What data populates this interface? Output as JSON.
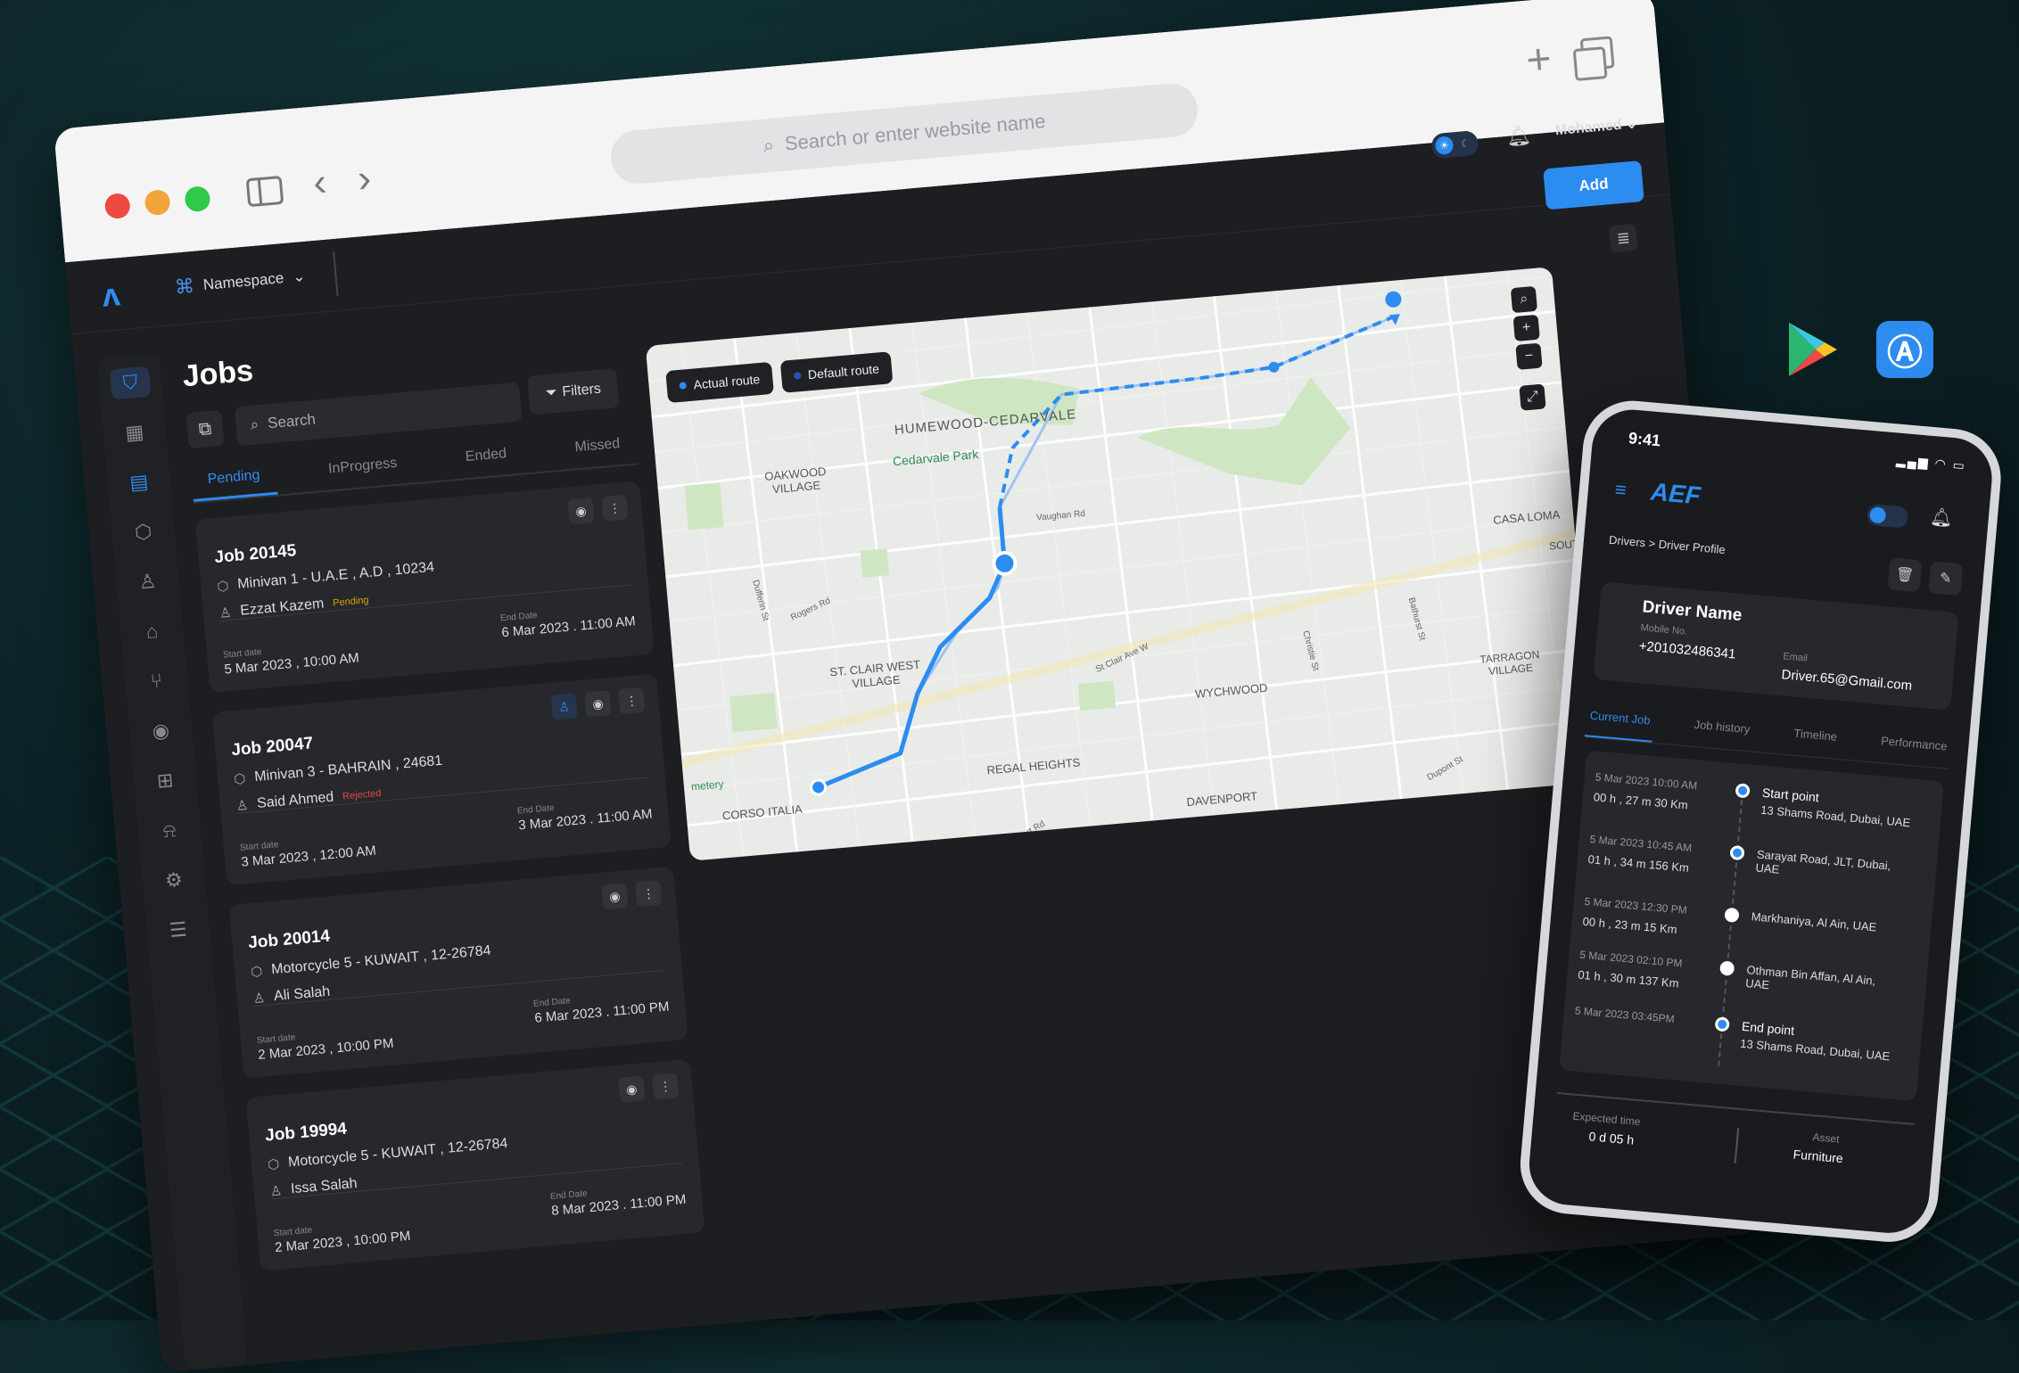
{
  "browser": {
    "url_placeholder": "Search or enter website name",
    "plus_icon": "+"
  },
  "app": {
    "namespace_label": "Namespace",
    "user_name": "Mohamed",
    "add_label": "Add",
    "jobs_title": "Jobs",
    "filters_label": "Filters",
    "search_placeholder": "Search",
    "tabs": [
      "Pending",
      "InProgress",
      "Ended",
      "Missed"
    ],
    "active_tab": "Pending",
    "start_label": "Start date",
    "end_label": "End Date",
    "jobs": [
      {
        "title": "Job 20145",
        "vehicle": "Minivan 1 - U.A.E , A.D , 10234",
        "driver": "Ezzat Kazem",
        "status": "Pending",
        "start": "5 Mar 2023 , 10:00 AM",
        "end": "6 Mar 2023 . 11:00 AM"
      },
      {
        "title": "Job 20047",
        "vehicle": "Minivan 3 - BAHRAIN , 24681",
        "driver": "Said Ahmed",
        "status": "Rejected",
        "start": "3 Mar 2023 , 12:00 AM",
        "end": "3 Mar 2023 . 11:00 AM"
      },
      {
        "title": "Job 20014",
        "vehicle": "Motorcycle 5 - KUWAIT , 12-26784",
        "driver": "Ali Salah",
        "status": "",
        "start": "2 Mar 2023 , 10:00 PM",
        "end": "6 Mar 2023 . 11:00 PM"
      },
      {
        "title": "Job 19994",
        "vehicle": "Motorcycle 5 - KUWAIT , 12-26784",
        "driver": "Issa Salah",
        "status": "",
        "start": "2 Mar 2023 , 10:00 PM",
        "end": "8 Mar 2023 . 11:00 PM"
      }
    ],
    "map": {
      "actual_route": "Actual route",
      "default_route": "Default route",
      "places": [
        "HUMEWOOD-CEDARVALE",
        "Cedarvale Park",
        "OAKWOOD VILLAGE",
        "CASA LOMA",
        "ST. CLAIR WEST VILLAGE",
        "WYCHWOOD",
        "TARRAGON VILLAGE",
        "REGAL HEIGHTS",
        "CORSO ITALIA",
        "DAVENPORT",
        "SOUTH",
        "Vaughan Rd",
        "St Clair Ave W",
        "Dufferin St",
        "Rogers Rd",
        "Bathurst St",
        "Christie St",
        "Davenport Rd",
        "Dupont St",
        "metery"
      ]
    }
  },
  "phone": {
    "time": "9:41",
    "logo": "AEF",
    "crumb_root": "Drivers",
    "crumb_sep": ">",
    "crumb_current": "Driver Profile",
    "driver_name": "Driver Name",
    "mobile_label": "Mobile No.",
    "mobile": "+201032486341",
    "email_label": "Email",
    "email": "Driver.65@Gmail.com",
    "tabs": [
      "Current Job",
      "Job history",
      "Timeline",
      "Performance"
    ],
    "timeline": [
      {
        "time": "5 Mar 2023 10:00 AM",
        "dur": "00 h , 27 m 30 Km",
        "title": "Start point",
        "addr": "13 Shams Road, Dubai, UAE"
      },
      {
        "time": "5 Mar 2023 10:45 AM",
        "dur": "01 h , 34 m 156 Km",
        "title": "",
        "addr": "Sarayat Road, JLT, Dubai, UAE"
      },
      {
        "time": "5 Mar 2023 12:30 PM",
        "dur": "00 h , 23 m 15 Km",
        "title": "",
        "addr": "Markhaniya, Al Ain, UAE"
      },
      {
        "time": "5 Mar 2023 02:10 PM",
        "dur": "01 h , 30 m 137 Km",
        "title": "",
        "addr": "Othman Bin Affan, Al Ain, UAE"
      },
      {
        "time": "5 Mar 2023 03:45PM",
        "dur": "",
        "title": "End point",
        "addr": "13 Shams Road, Dubai, UAE"
      }
    ],
    "expected_label": "Expected time",
    "expected_value": "0 d 05 h",
    "asset_label": "Asset",
    "asset_value": "Furniture"
  },
  "colors": {
    "accent": "#2d8cf0",
    "pending": "#d9a400",
    "rejected": "#e54747"
  }
}
